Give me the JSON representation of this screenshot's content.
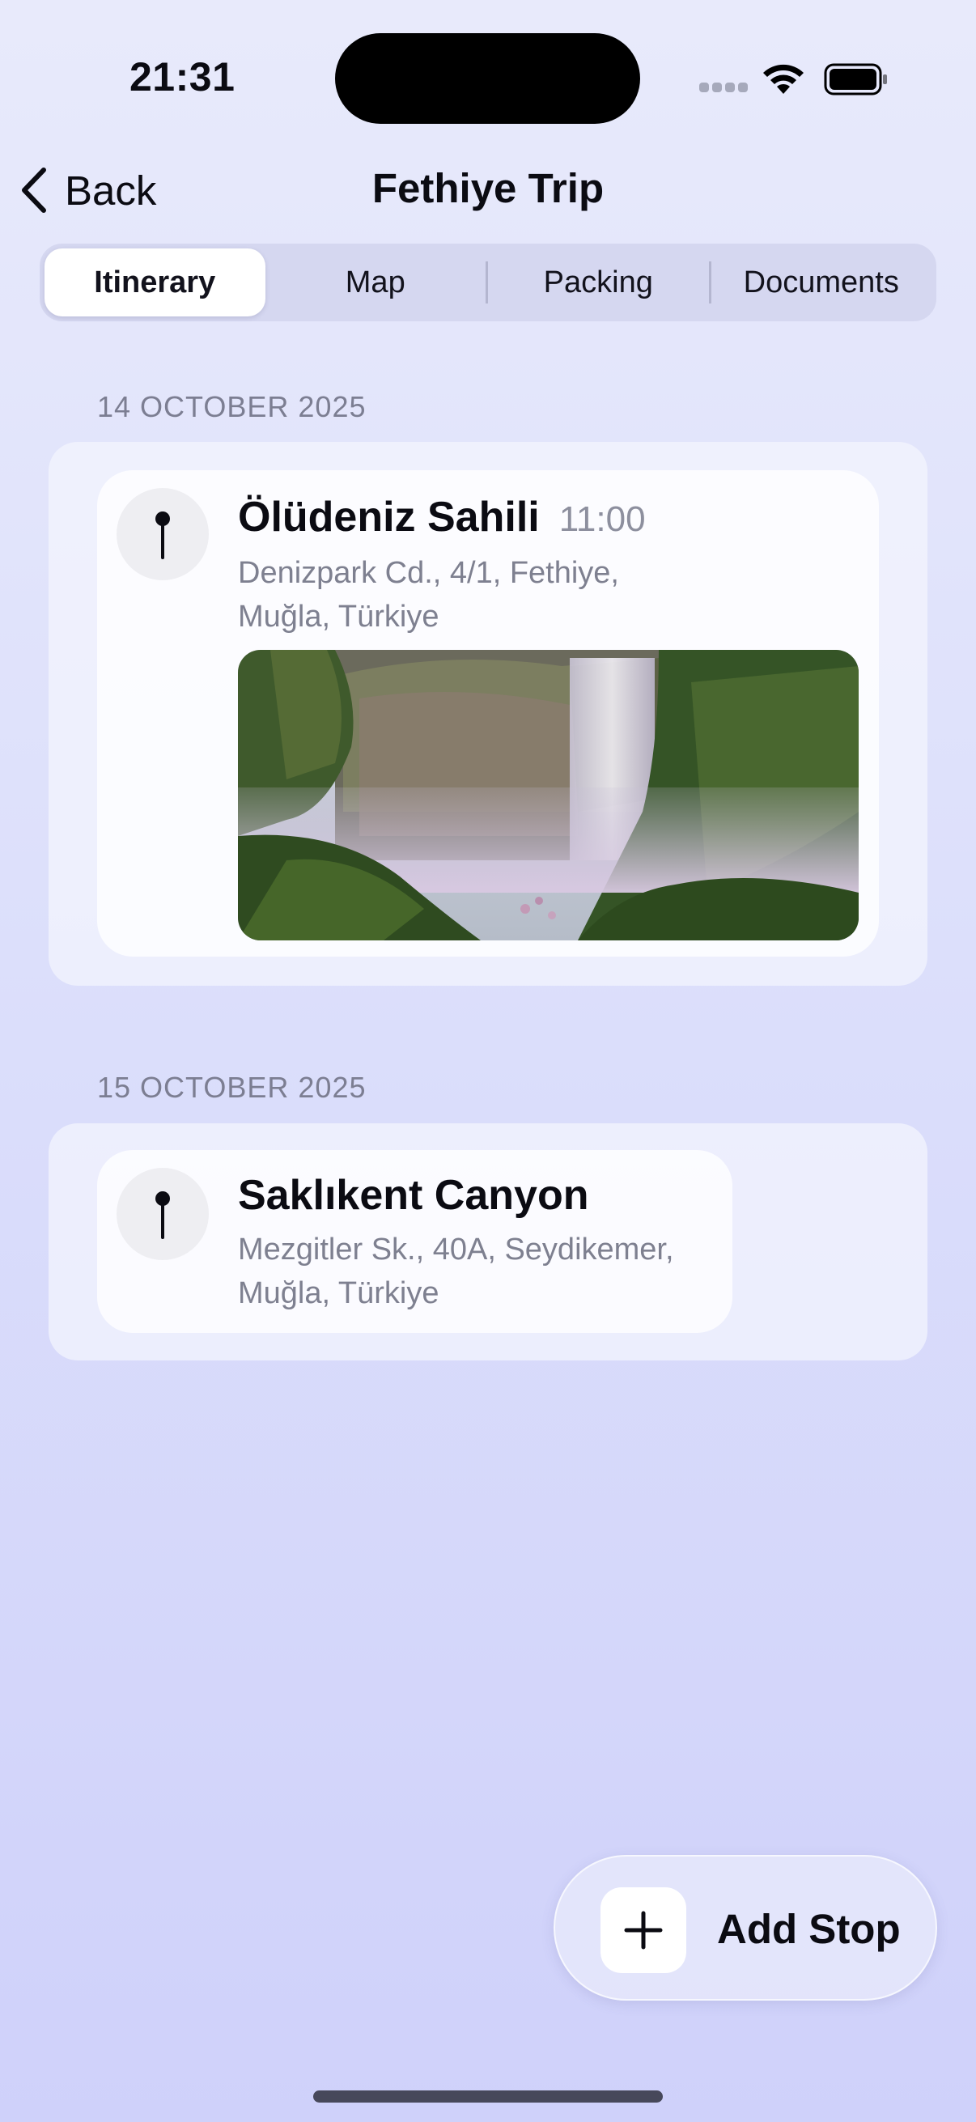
{
  "status_bar": {
    "time": "21:31"
  },
  "nav": {
    "back_label": "Back",
    "title": "Fethiye Trip"
  },
  "tabs": [
    {
      "label": "Itinerary",
      "active": true
    },
    {
      "label": "Map",
      "active": false
    },
    {
      "label": "Packing",
      "active": false
    },
    {
      "label": "Documents",
      "active": false
    }
  ],
  "sections": [
    {
      "date": "14 OCTOBER 2025",
      "stops": [
        {
          "title": "Ölüdeniz Sahili",
          "time": "11:00",
          "address_line1": "Denizpark Cd., 4/1, Fethiye,",
          "address_line2": "Muğla, Türkiye",
          "icon": "pin-icon",
          "photo": "waterfall-photo"
        }
      ]
    },
    {
      "date": "15 OCTOBER 2025",
      "stops": [
        {
          "title": "Saklıkent Canyon",
          "address_line1": "Mezgitler Sk., 40A, Seydikemer,",
          "address_line2": "Muğla, Türkiye",
          "icon": "pin-icon"
        }
      ]
    }
  ],
  "add_stop": {
    "label": "Add Stop",
    "icon": "plus-icon"
  },
  "colors": {
    "background_top": "#e8eafb",
    "background_bottom": "#cfd1fa",
    "secondary_text": "#7e8090"
  }
}
